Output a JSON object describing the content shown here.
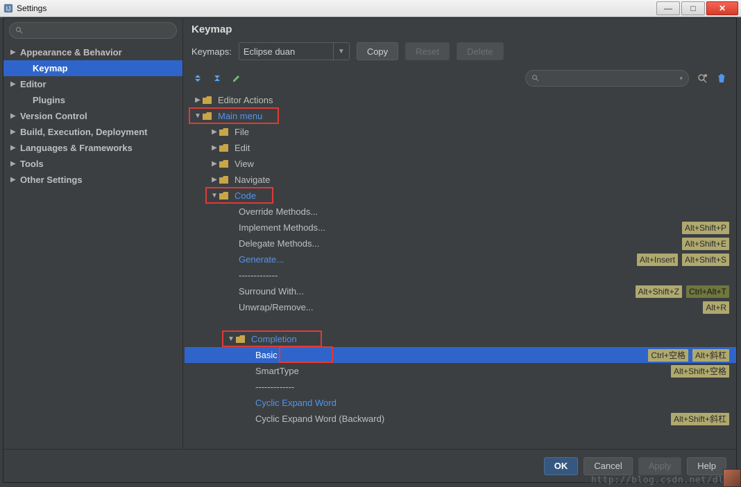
{
  "window": {
    "title": "Settings"
  },
  "sidebar": {
    "items": [
      {
        "label": "Appearance & Behavior",
        "caret": true,
        "indent": false
      },
      {
        "label": "Keymap",
        "caret": false,
        "indent": true,
        "selected": true
      },
      {
        "label": "Editor",
        "caret": true,
        "indent": false
      },
      {
        "label": "Plugins",
        "caret": false,
        "indent": true
      },
      {
        "label": "Version Control",
        "caret": true,
        "indent": false
      },
      {
        "label": "Build, Execution, Deployment",
        "caret": true,
        "indent": false
      },
      {
        "label": "Languages & Frameworks",
        "caret": true,
        "indent": false
      },
      {
        "label": "Tools",
        "caret": true,
        "indent": false
      },
      {
        "label": "Other Settings",
        "caret": true,
        "indent": false
      }
    ]
  },
  "main": {
    "heading": "Keymap",
    "keymaps_label": "Keymaps:",
    "combo_value": "Eclipse duan",
    "copy": "Copy",
    "reset": "Reset",
    "delete": "Delete",
    "filter_prefix": "Q"
  },
  "tree": {
    "rows": [
      {
        "depth": 0,
        "exp": "▶",
        "folder": true,
        "label": "Editor Actions"
      },
      {
        "depth": 0,
        "exp": "▼",
        "folder": true,
        "label": "Main menu",
        "link": true,
        "hl": "mm"
      },
      {
        "depth": 1,
        "exp": "▶",
        "folder": true,
        "label": "File"
      },
      {
        "depth": 1,
        "exp": "▶",
        "folder": true,
        "label": "Edit"
      },
      {
        "depth": 1,
        "exp": "▶",
        "folder": true,
        "label": "View"
      },
      {
        "depth": 1,
        "exp": "▶",
        "folder": true,
        "label": "Navigate"
      },
      {
        "depth": 1,
        "exp": "▼",
        "folder": true,
        "label": "Code",
        "link": true,
        "hl": "code"
      },
      {
        "depth": 2,
        "label": "Override Methods..."
      },
      {
        "depth": 2,
        "label": "Implement Methods...",
        "shorts": [
          "Alt+Shift+P"
        ]
      },
      {
        "depth": 2,
        "label": "Delegate Methods...",
        "shorts": [
          "Alt+Shift+E"
        ]
      },
      {
        "depth": 2,
        "label": "Generate...",
        "link": true,
        "shorts": [
          "Alt+Insert",
          "Alt+Shift+S"
        ]
      },
      {
        "depth": 2,
        "label": "-------------"
      },
      {
        "depth": 2,
        "label": "Surround With...",
        "shorts": [
          "Alt+Shift+Z",
          "Ctrl+Alt+T"
        ],
        "darks": [
          false,
          true
        ]
      },
      {
        "depth": 2,
        "label": "Unwrap/Remove...",
        "shorts": [
          "Alt+R"
        ]
      },
      {
        "depth": 2,
        "label": ""
      },
      {
        "depth": 2,
        "exp": "▼",
        "folder": true,
        "label": "Completion",
        "link": true,
        "hl": "comp"
      },
      {
        "depth": 3,
        "label": "Basic",
        "selected": true,
        "shorts": [
          "Ctrl+空格",
          "Alt+斜杠"
        ],
        "hl": "basic"
      },
      {
        "depth": 3,
        "label": "SmartType",
        "shorts": [
          "Alt+Shift+空格"
        ]
      },
      {
        "depth": 3,
        "label": "-------------"
      },
      {
        "depth": 3,
        "label": "Cyclic Expand Word",
        "link": true
      },
      {
        "depth": 3,
        "label": "Cyclic Expand Word (Backward)",
        "shorts": [
          "Alt+Shift+斜杠"
        ]
      }
    ]
  },
  "footer": {
    "ok": "OK",
    "cancel": "Cancel",
    "apply": "Apply",
    "help": "Help"
  },
  "watermark": "http://blog.csdn.net/dlz_"
}
